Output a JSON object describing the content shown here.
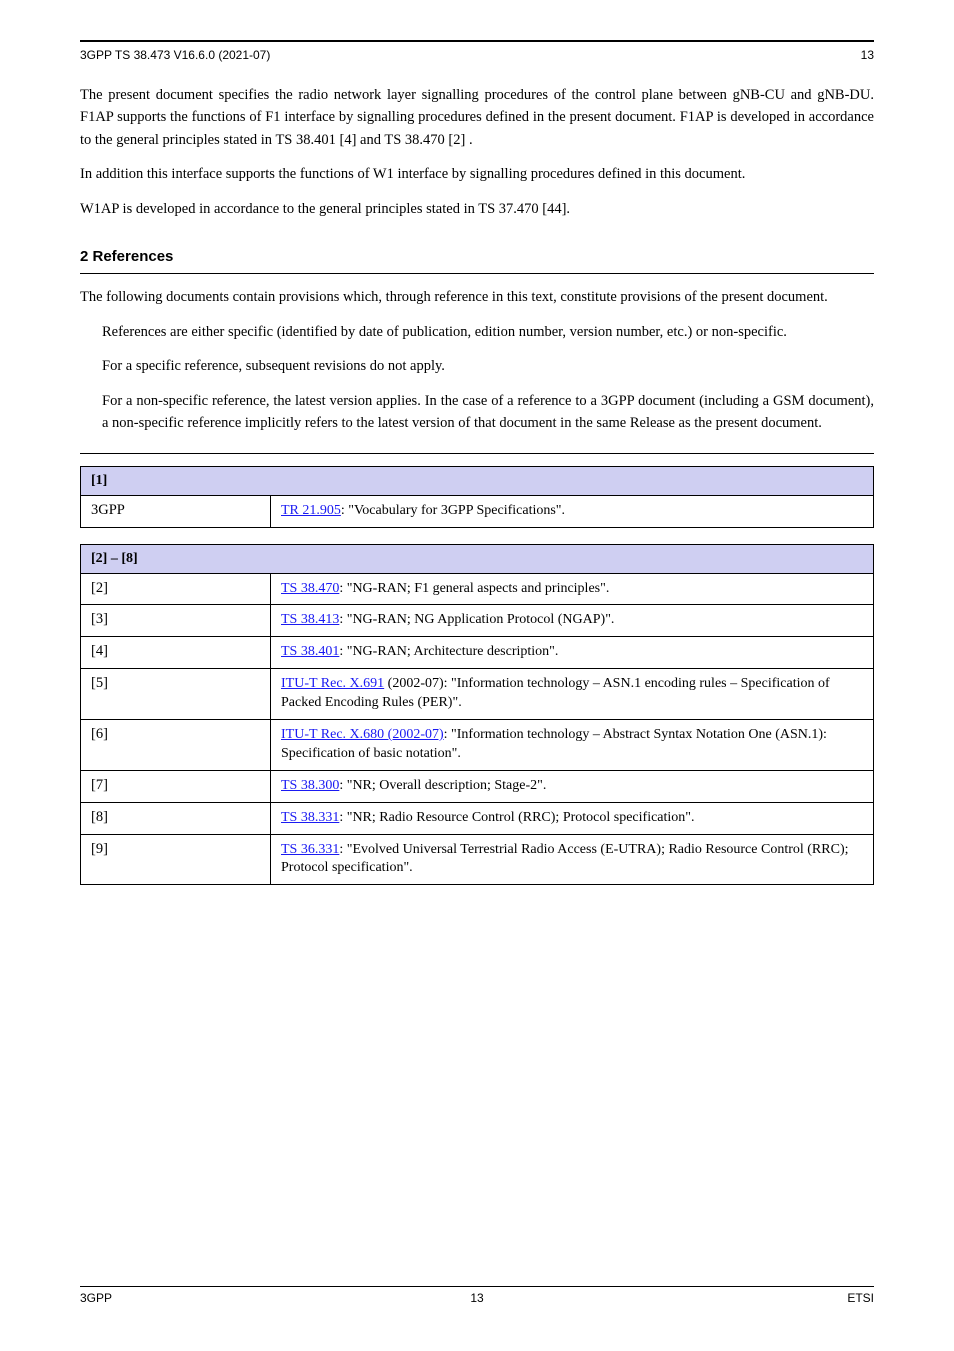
{
  "header": {
    "left": "3GPP TS 38.473 V16.6.0 (2021-07)",
    "right": "13"
  },
  "title": {
    "intro_small": "The present document specifies the radio network layer signalling procedures of the control plane between gNB-CU and gNB-DU. F1AP supports the functions of F1 interface by signalling procedures defined in the present document. F1AP is developed in accordance to the general principles stated in ",
    "ref1": "TS 38.401 [4]",
    "mid": " and ",
    "ref2": "TS 38.470 [2]",
    "end": "."
  },
  "desc2": "In addition this interface supports the functions of W1 interface by signalling procedures defined in this document.",
  "desc3": "W1AP is developed in accordance to the general principles stated in TS 37.470 [44].",
  "references_heading": "2   References",
  "ref_intro": "The following documents contain provisions which, through reference in this text, constitute provisions of the present document.",
  "bullet1": "References are either specific (identified by date of publication, edition number, version number, etc.) or non-specific.",
  "bullet2": "For a specific reference, subsequent revisions do not apply.",
  "bullet3": "For a non-specific reference, the latest version applies. In the case of a reference to a 3GPP document (including a GSM document), a non-specific reference implicitly refers to the latest version of that document in the same Release as the present document.",
  "table": {
    "group1": {
      "header": "[1]",
      "label": "3GPP",
      "link": "TR 21.905",
      "desc": ": \"Vocabulary for 3GPP Specifications\"."
    },
    "group2": {
      "header": "[2] – [8]",
      "rows": [
        {
          "label": "[2]",
          "link": "TS 38.470",
          "desc": ": \"NG-RAN; F1 general aspects and principles\"."
        },
        {
          "label": "[3]",
          "link": "TS 38.413",
          "desc": ": \"NG-RAN; NG Application Protocol (NGAP)\"."
        },
        {
          "label": "[4]",
          "link": "TS 38.401",
          "desc": ": \"NG-RAN; Architecture description\"."
        },
        {
          "label": "[5]",
          "link": "ITU-T Rec. X.691",
          "desc": " (2002-07): \"Information technology – ASN.1 encoding rules – Specification of Packed Encoding Rules (PER)\"."
        },
        {
          "label": "[6]",
          "link": "ITU-T Rec. X.680 (2002-07)",
          "desc": ": \"Information technology – Abstract Syntax Notation One (ASN.1): Specification of basic notation\"."
        },
        {
          "label": "[7]",
          "link": "TS 38.300",
          "desc": ": \"NR; Overall description; Stage-2\"."
        },
        {
          "label": "[8]",
          "link": "TS 38.331",
          "desc": ": \"NR; Radio Resource Control (RRC); Protocol specification\"."
        }
      ]
    },
    "row9": {
      "label": "[9]",
      "link": "TS 36.331",
      "desc": ": \"Evolved Universal Terrestrial Radio Access (E-UTRA); Radio Resource Control (RRC); Protocol specification\"."
    }
  },
  "footer": {
    "left": "3GPP",
    "center": "13",
    "right": "ETSI"
  }
}
